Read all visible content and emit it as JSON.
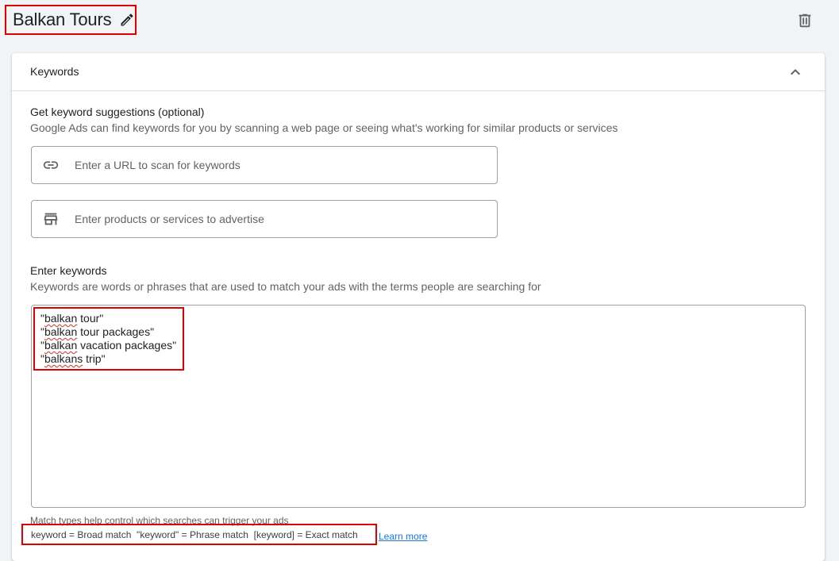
{
  "header": {
    "title": "Balkan Tours",
    "edit_icon": "pencil-icon",
    "delete_icon": "trash-icon"
  },
  "card": {
    "title": "Keywords",
    "collapse_icon": "chevron-up-icon"
  },
  "suggestions": {
    "heading": "Get keyword suggestions (optional)",
    "description": "Google Ads can find keywords for you by scanning a web page or seeing what's working for similar products or services",
    "url_input": {
      "icon": "link-icon",
      "placeholder": "Enter a URL to scan for keywords",
      "value": ""
    },
    "products_input": {
      "icon": "store-icon",
      "placeholder": "Enter products or services to advertise",
      "value": ""
    }
  },
  "keywords": {
    "heading": "Enter keywords",
    "description": "Keywords are words or phrases that are used to match your ads with the terms people are searching for",
    "lines": [
      {
        "open": "\"",
        "misspelled": "balkan",
        "rest": " tour\""
      },
      {
        "open": "\"",
        "misspelled": "balkan",
        "rest": " tour packages\""
      },
      {
        "open": "\"",
        "misspelled": "balkan",
        "rest": " vacation packages\""
      },
      {
        "open": "\"",
        "misspelled": "balkans",
        "rest": " trip\""
      }
    ],
    "match_help": "Match types help control which searches can trigger your ads",
    "match_legend": "keyword = Broad match  \"keyword\" = Phrase match  [keyword] = Exact match",
    "learn_more": "Learn more"
  },
  "colors": {
    "highlight_border": "#e00000",
    "link": "#1a73e8",
    "page_bg": "#f1f3f4"
  }
}
